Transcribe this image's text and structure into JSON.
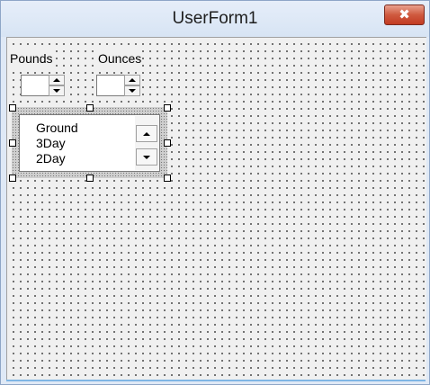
{
  "window": {
    "title": "UserForm1",
    "close_symbol": "✖"
  },
  "labels": {
    "pounds": "Pounds",
    "ounces": "Ounces"
  },
  "spinners": [
    {
      "name": "pounds",
      "value": ""
    },
    {
      "name": "ounces",
      "value": ""
    }
  ],
  "listbox": {
    "items": [
      "Ground",
      "3Day",
      "2Day"
    ]
  },
  "colors": {
    "titlebar": "#dfe9f6",
    "close_button": "#c94a30",
    "grid_dot": "#000000",
    "form_background": "#f0f0f0"
  },
  "icons": {
    "close": "close-icon",
    "scroll_up": "scroll-up-arrow-icon",
    "scroll_down": "scroll-down-arrow-icon"
  }
}
